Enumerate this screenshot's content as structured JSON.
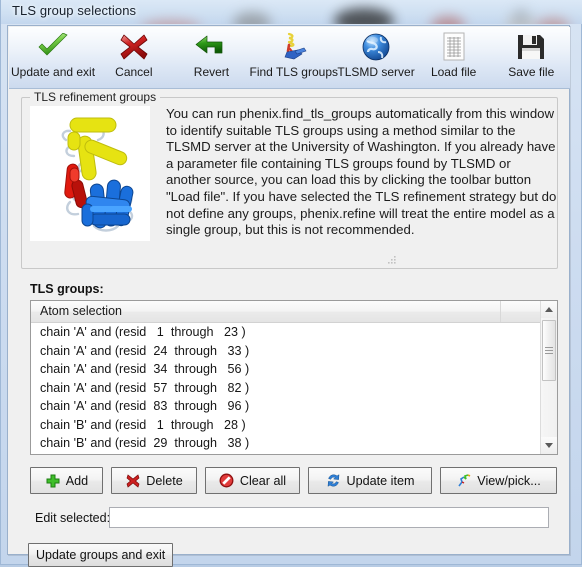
{
  "window": {
    "title": "TLS group selections"
  },
  "toolbar": {
    "items": [
      {
        "label": "Update and exit",
        "icon": "green-check-icon"
      },
      {
        "label": "Cancel",
        "icon": "red-x-icon"
      },
      {
        "label": "Revert",
        "icon": "green-left-arrow-icon"
      },
      {
        "label": "Find TLS groups",
        "icon": "molecule-icon"
      },
      {
        "label": "TLSMD server",
        "icon": "blue-globe-icon"
      },
      {
        "label": "Load file",
        "icon": "document-grid-icon"
      },
      {
        "label": "Save file",
        "icon": "floppy-disk-icon"
      }
    ]
  },
  "groupbox": {
    "legend": "TLS refinement groups",
    "thumbnail_alt": "protein-ribbon-image",
    "description": "You can run phenix.find_tls_groups automatically from this window to identify suitable TLS groups using a method similar to the TLSMD server at the University of Washington.  If you already have a parameter file containing TLS groups found by TLSMD or another source, you can load this by clicking the toolbar button \"Load file\".  If you have selected the TLS refinement strategy but do not define any groups, phenix.refine will treat the entire model as a single group, but this is not recommended."
  },
  "list": {
    "label": "TLS groups:",
    "columns": [
      "Atom selection"
    ],
    "rows": [
      "chain 'A' and (resid   1  through   23 )",
      "chain 'A' and (resid  24  through   33 )",
      "chain 'A' and (resid  34  through   56 )",
      "chain 'A' and (resid  57  through   82 )",
      "chain 'A' and (resid  83  through   96 )",
      "chain 'B' and (resid   1  through   28 )",
      "chain 'B' and (resid  29  through   38 )"
    ]
  },
  "buttons": {
    "add": "Add",
    "delete": "Delete",
    "clear_all": "Clear all",
    "update_item": "Update item",
    "view_pick": "View/pick..."
  },
  "edit": {
    "label": "Edit selected:",
    "value": "",
    "placeholder": ""
  },
  "bottom": {
    "update_groups_and_exit": "Update groups and exit"
  },
  "colors": {
    "accent_green": "#3fa526",
    "accent_red": "#cc2222",
    "accent_blue": "#2a6fc4",
    "window_glass": "#cfe0f2",
    "panel": "#f0f0f0"
  }
}
